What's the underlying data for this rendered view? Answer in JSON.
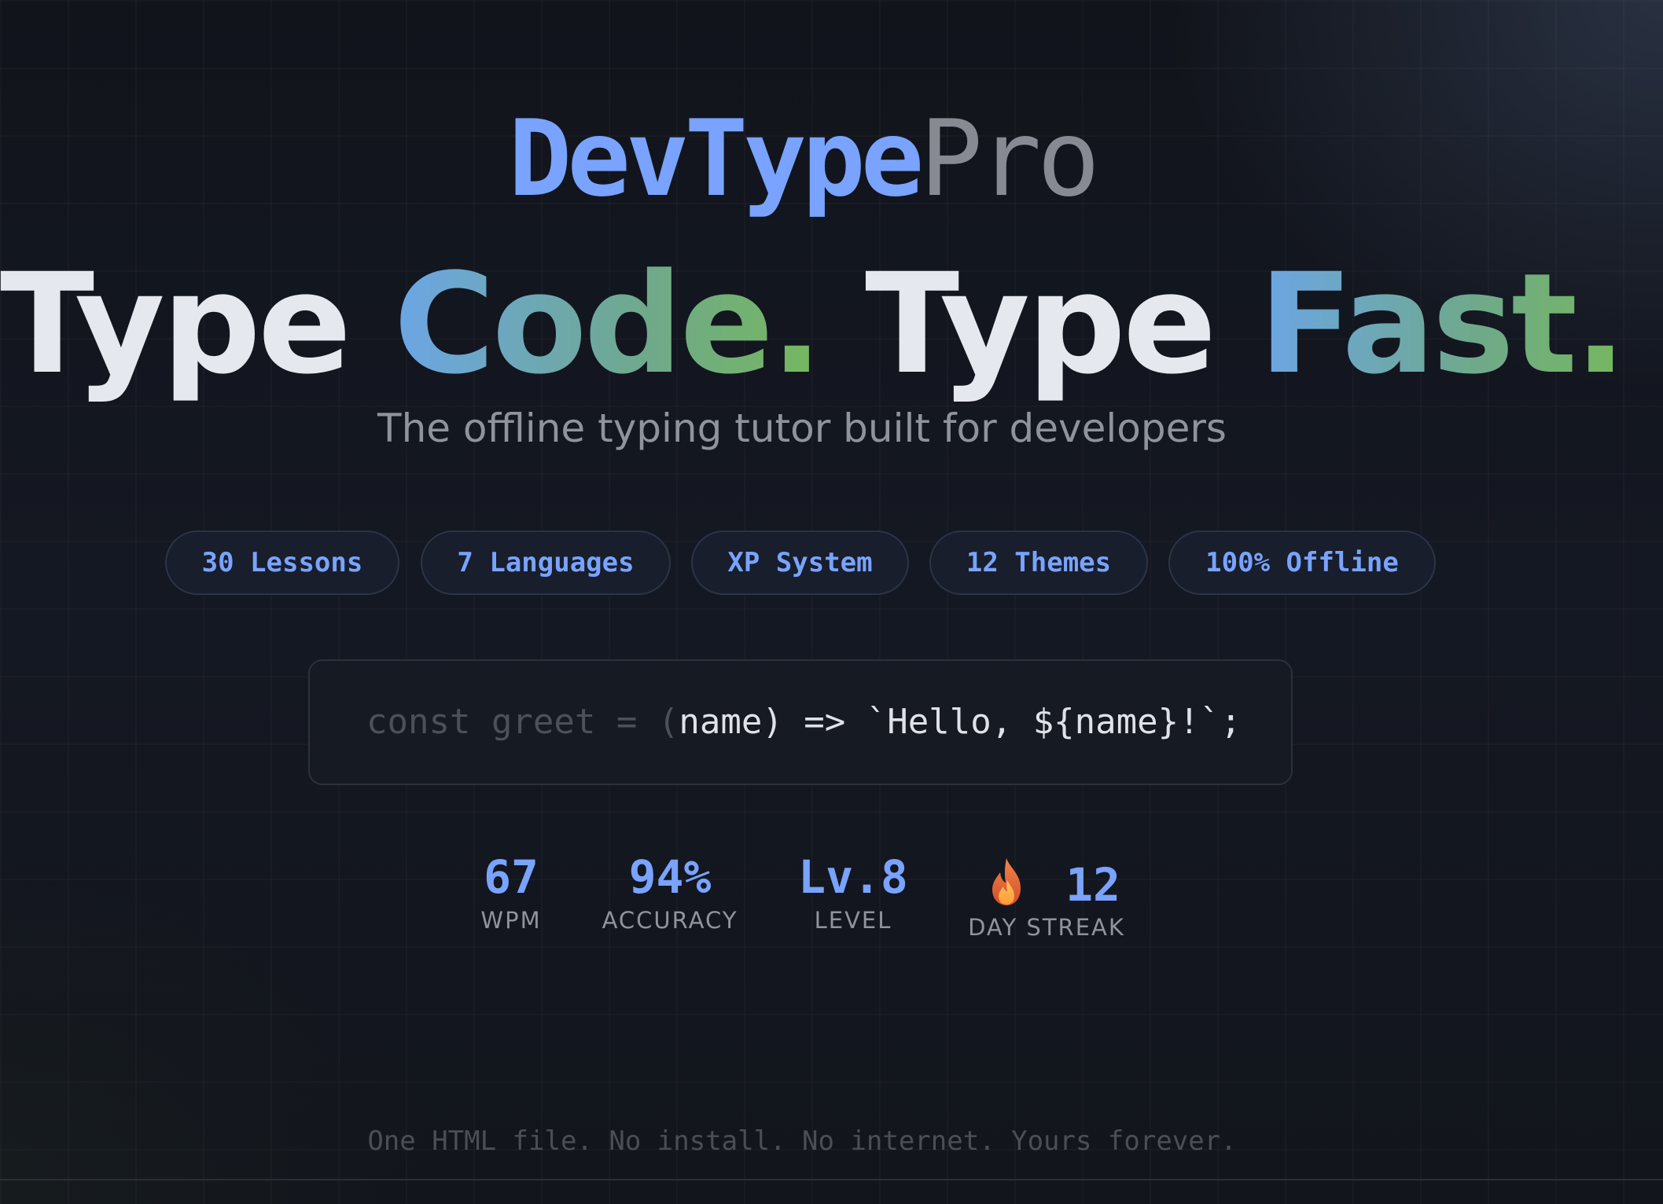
{
  "brand": {
    "part1": "DevType",
    "part2": "Pro"
  },
  "headline": {
    "word1": "Type",
    "word2": "Code.",
    "word3": "Type",
    "word4": "Fast."
  },
  "subtitle": "The offline typing tutor built for developers",
  "features": [
    "30 Lessons",
    "7 Languages",
    "XP System",
    "12 Themes",
    "100% Offline"
  ],
  "code": {
    "typed": "const greet = (",
    "remaining": "name) => `Hello, ${name}!`;"
  },
  "stats": {
    "wpm": {
      "value": "67",
      "label": "WPM"
    },
    "accuracy": {
      "value": "94%",
      "label": "ACCURACY"
    },
    "level": {
      "value": "Lv.8",
      "label": "LEVEL"
    },
    "streak": {
      "value": "12",
      "label": "DAY STREAK",
      "icon": "fire-icon"
    }
  },
  "tagline": "One HTML file. No install. No internet. Yours forever.",
  "colors": {
    "accent": "#79a3ff",
    "muted": "#878a92",
    "background": "#11141b"
  }
}
